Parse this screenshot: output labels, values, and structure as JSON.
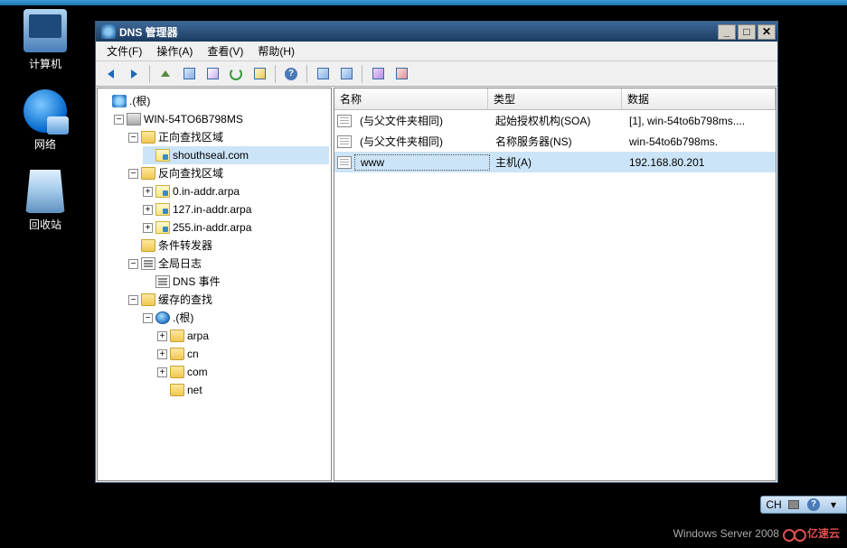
{
  "desktop": {
    "icons": [
      {
        "label": "计算机",
        "name": "computer"
      },
      {
        "label": "网络",
        "name": "network"
      },
      {
        "label": "回收站",
        "name": "recycle-bin"
      }
    ]
  },
  "window": {
    "title": "DNS 管理器",
    "menu": [
      "文件(F)",
      "操作(A)",
      "查看(V)",
      "帮助(H)"
    ]
  },
  "tree": {
    "root": ".(根)",
    "server": "WIN-54TO6B798MS",
    "forward_zone": "正向查找区域",
    "forward_domain": "shouthseal.com",
    "reverse_zone": "反向查找区域",
    "reverse_items": [
      "0.in-addr.arpa",
      "127.in-addr.arpa",
      "255.in-addr.arpa"
    ],
    "forwarders": "条件转发器",
    "global_log": "全局日志",
    "dns_event": "DNS 事件",
    "cached": "缓存的查找",
    "root_items": [
      "arpa",
      "cn",
      "com",
      "net"
    ]
  },
  "list": {
    "headers": {
      "name": "名称",
      "type": "类型",
      "data": "数据"
    },
    "rows": [
      {
        "name": "(与父文件夹相同)",
        "type": "起始授权机构(SOA)",
        "data": "[1], win-54to6b798ms...."
      },
      {
        "name": "(与父文件夹相同)",
        "type": "名称服务器(NS)",
        "data": "win-54to6b798ms."
      },
      {
        "name": "www",
        "type": "主机(A)",
        "data": "192.168.80.201"
      }
    ]
  },
  "tray": {
    "lang": "CH"
  },
  "footer": {
    "os": "Windows Server 2008",
    "brand": "亿速云"
  }
}
